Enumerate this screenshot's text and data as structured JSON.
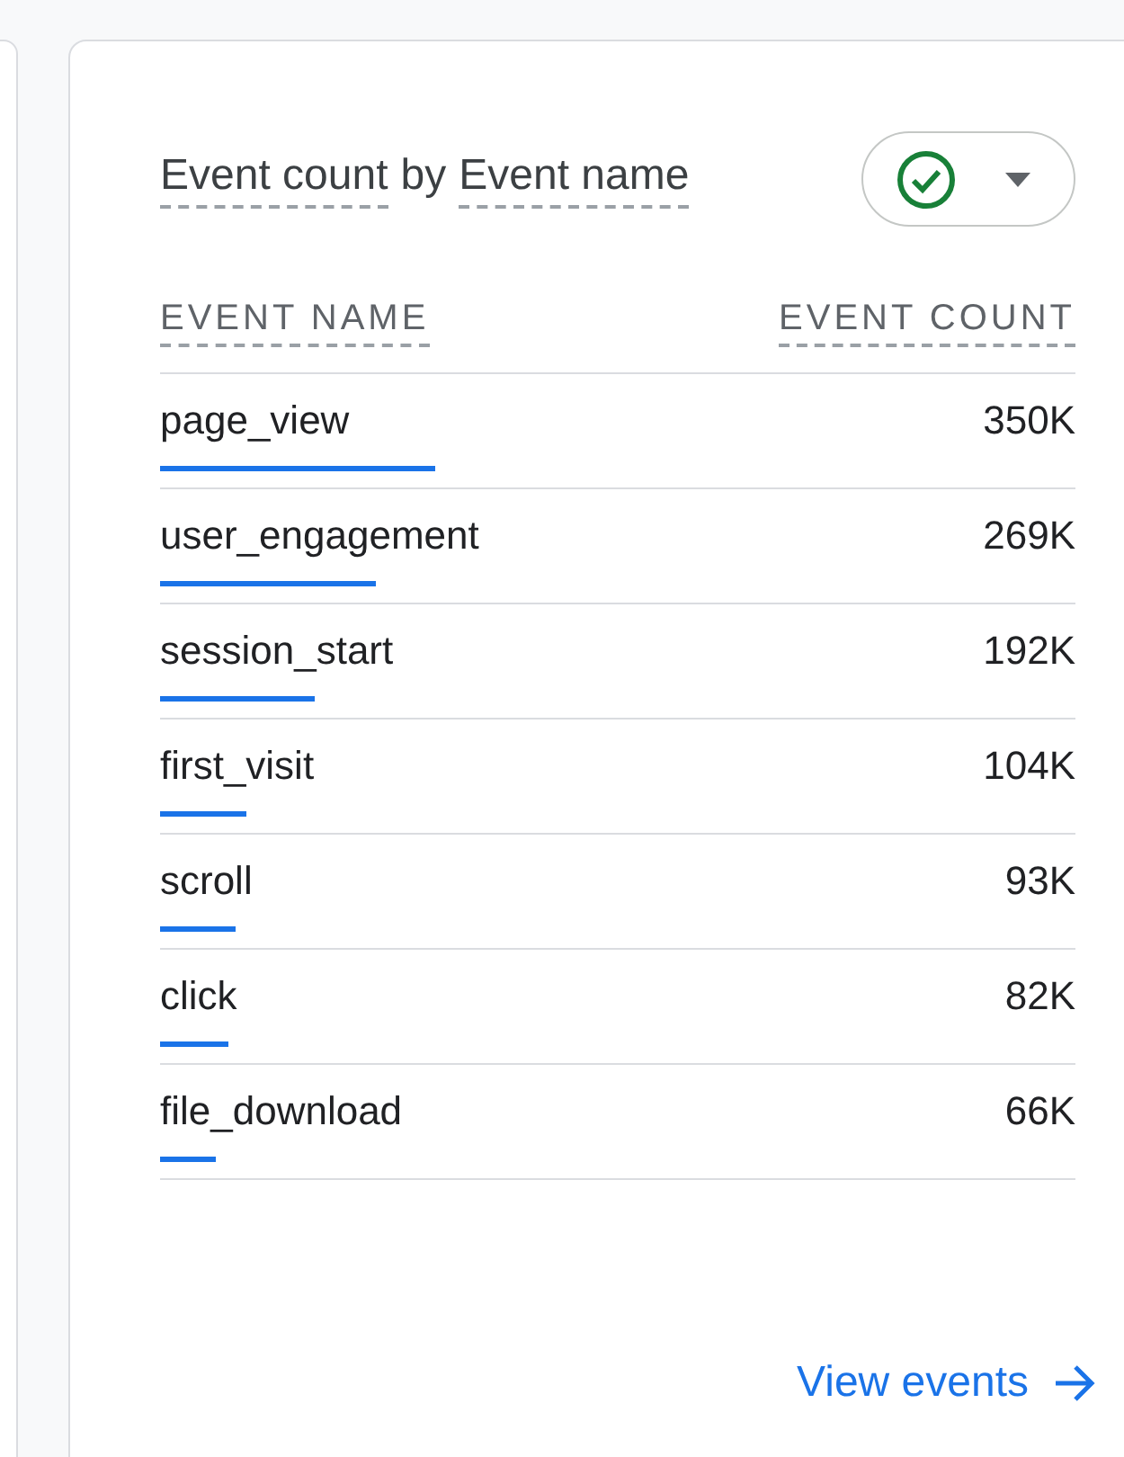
{
  "card": {
    "title_parts": [
      "Event count",
      "by",
      "Event name"
    ],
    "verified": true
  },
  "table": {
    "columns": [
      "EVENT NAME",
      "EVENT COUNT"
    ],
    "rows": [
      {
        "name": "page_view",
        "count": "350K",
        "level": 0.3
      },
      {
        "name": "user_engagement",
        "count": "269K",
        "level": 0.235
      },
      {
        "name": "session_start",
        "count": "192K",
        "level": 0.168
      },
      {
        "name": "first_visit",
        "count": "104K",
        "level": 0.094
      },
      {
        "name": "scroll",
        "count": "93K",
        "level": 0.082
      },
      {
        "name": "click",
        "count": "82K",
        "level": 0.074
      },
      {
        "name": "file_download",
        "count": "66K",
        "level": 0.06
      }
    ]
  },
  "link": {
    "label": "View events"
  }
}
